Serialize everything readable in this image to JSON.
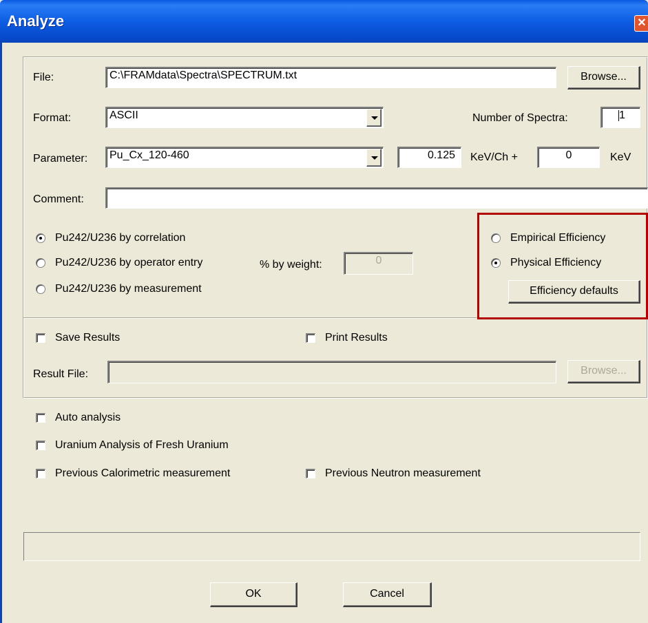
{
  "window": {
    "title": "Analyze",
    "close_glyph": "✕"
  },
  "file": {
    "label": "File:",
    "value": "C:\\FRAMdata\\Spectra\\SPECTRUM.txt",
    "browse_label": "Browse..."
  },
  "format": {
    "label": "Format:",
    "value": "ASCII"
  },
  "spectra": {
    "label": "Number of Spectra:",
    "value": "1"
  },
  "parameter": {
    "label": "Parameter:",
    "value": "Pu_Cx_120-460",
    "gain": "0.125",
    "gain_unit": "KeV/Ch +",
    "offset": "0",
    "offset_unit": "KeV"
  },
  "comment": {
    "label": "Comment:",
    "value": ""
  },
  "pu242": {
    "options": [
      "Pu242/U236 by correlation",
      "Pu242/U236 by operator entry",
      "Pu242/U236 by measurement"
    ],
    "selected": 0,
    "weight_label": "% by weight:",
    "weight_value": "0"
  },
  "efficiency": {
    "options": [
      "Empirical Efficiency",
      "Physical Efficiency"
    ],
    "selected": 1,
    "defaults_label": "Efficiency defaults",
    "highlight_color": "#b00000"
  },
  "results": {
    "save_label": "Save Results",
    "save_checked": false,
    "print_label": "Print Results",
    "print_checked": false,
    "file_label": "Result File:",
    "file_value": "",
    "browse_label": "Browse..."
  },
  "options": {
    "auto_label": "Auto analysis",
    "uranium_label": "Uranium Analysis of Fresh Uranium",
    "calorimetric_label": "Previous Calorimetric measurement",
    "neutron_label": "Previous Neutron measurement"
  },
  "buttons": {
    "ok_label": "OK",
    "cancel_label": "Cancel"
  },
  "colors": {
    "titlebar": "#0a58e0",
    "dialog_bg": "#ece9d8",
    "close_button": "#e0542e"
  }
}
